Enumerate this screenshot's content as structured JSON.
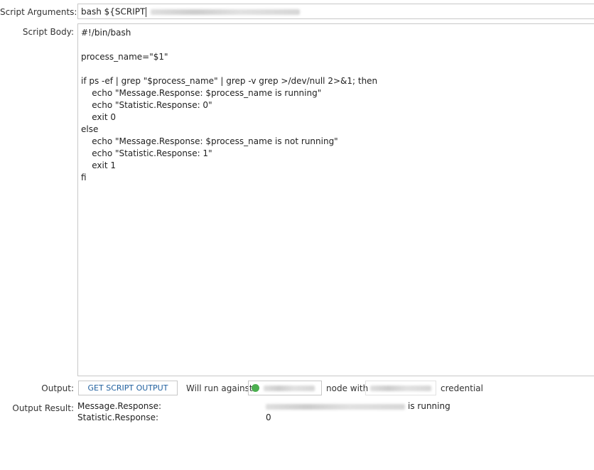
{
  "form": {
    "script_arguments_label": "Script Arguments:",
    "script_arguments_value": "bash ${SCRIPT",
    "script_body_label": "Script Body:",
    "script_body_lines": [
      "#!/bin/bash",
      "",
      "process_name=\"$1\"",
      "",
      "if ps -ef | grep \"$process_name\" | grep -v grep >/dev/null 2>&1; then",
      "    echo \"Message.Response: $process_name is running\"",
      "    echo \"Statistic.Response: 0\"",
      "    exit 0",
      "else",
      "    echo \"Message.Response: $process_name is not running\"",
      "    echo \"Statistic.Response: 1\"",
      "    exit 1",
      "fi"
    ],
    "output_label": "Output:",
    "get_script_output_button": "GET SCRIPT OUTPUT",
    "will_run_against_text": "Will run against",
    "node_with_text": "node with",
    "credential_text": "credential",
    "node_status_color": "#4caf50",
    "output_result_label": "Output Result:",
    "output_results": [
      {
        "key": "Message.Response:",
        "value": "is running"
      },
      {
        "key": "Statistic.Response:",
        "value": "0"
      }
    ]
  }
}
